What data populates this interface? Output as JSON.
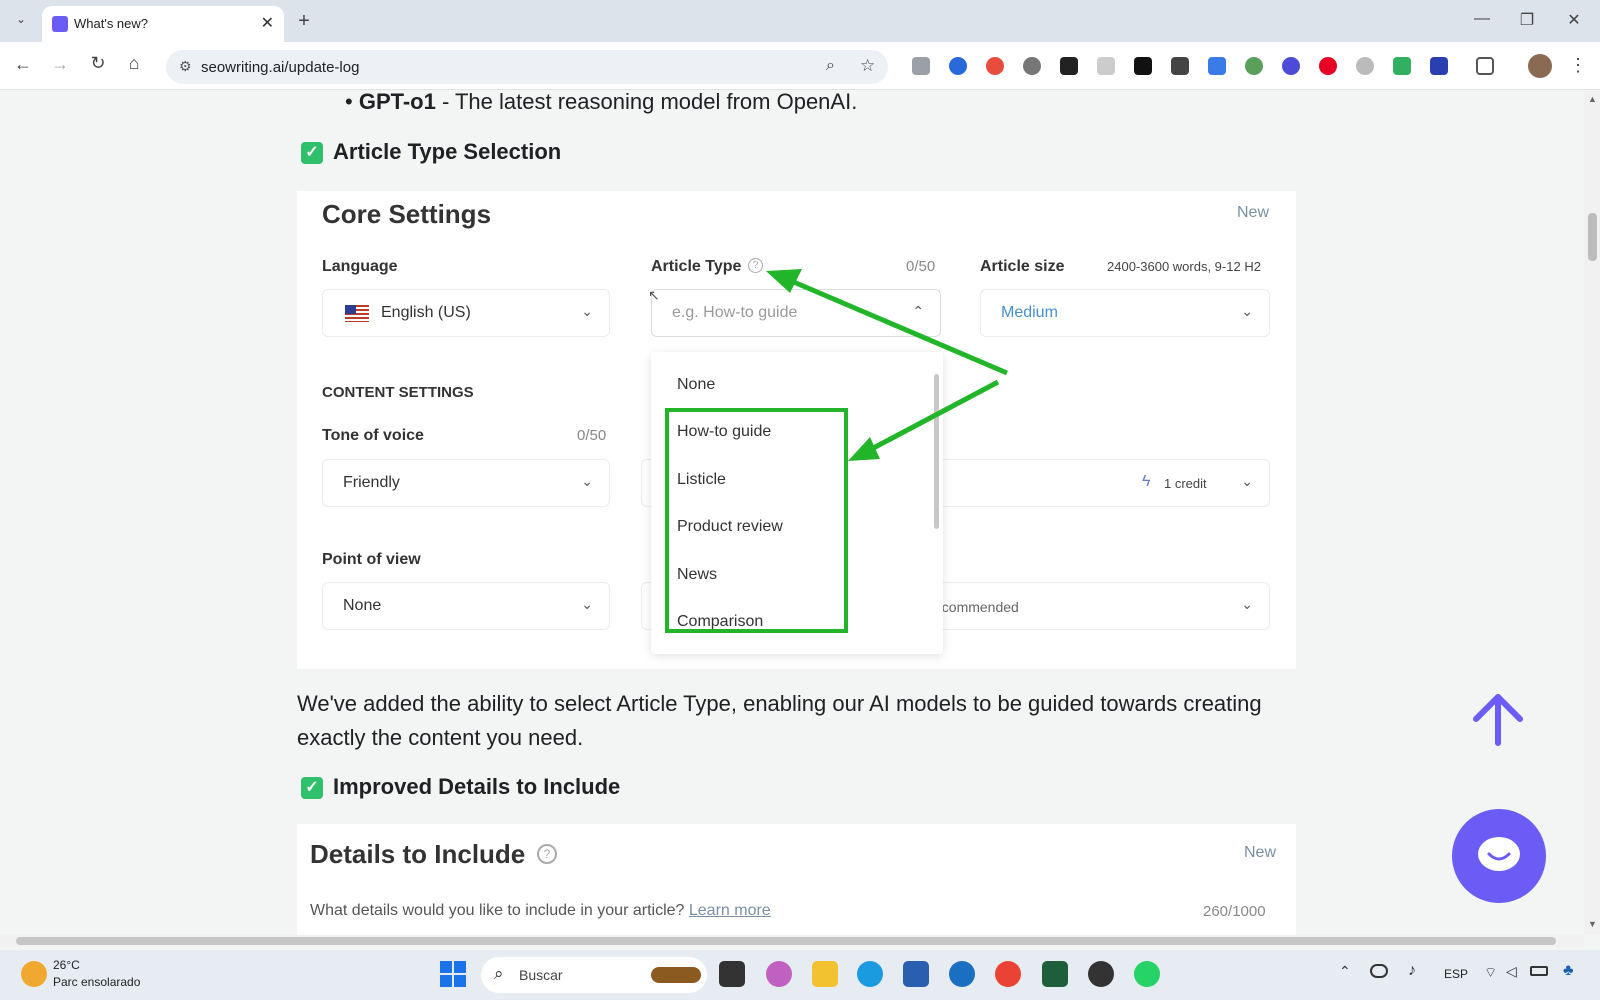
{
  "browser": {
    "tab_title": "What's new?",
    "tab_close": "✕",
    "new_tab": "+",
    "url": "seowriting.ai/update-log",
    "window_controls": [
      "—",
      "❐",
      "✕"
    ]
  },
  "page": {
    "bullet_bold": "GPT-o1",
    "bullet_rest": " - The latest reasoning model from OpenAI.",
    "section1_title": "Article Type Selection",
    "core": {
      "title": "Core Settings",
      "badge": "New",
      "language_label": "Language",
      "language_value": "English (US)",
      "article_type_label": "Article Type",
      "article_type_counter": "0/50",
      "article_type_placeholder": "e.g. How-to guide",
      "article_size_label": "Article size",
      "article_size_hint": "2400-3600 words, 9-12 H2",
      "article_size_value": "Medium",
      "content_settings": "CONTENT SETTINGS",
      "tone_label": "Tone of voice",
      "tone_counter": "0/50",
      "tone_value": "Friendly",
      "credit_text": "1 credit",
      "pov_label": "Point of view",
      "pov_value": "None",
      "recommended_text": "ecommended"
    },
    "dropdown_items": [
      "None",
      "How-to guide",
      "Listicle",
      "Product review",
      "News",
      "Comparison"
    ],
    "paragraph": "We've added the ability to select Article Type, enabling our AI models to be guided towards creating exactly the content you need.",
    "section2_title": "Improved Details to Include",
    "details": {
      "title": "Details to Include",
      "badge": "New",
      "prompt": "What details would you like to include in your article?",
      "learn_more": "Learn more",
      "counter": "260/1000"
    }
  },
  "taskbar": {
    "temp": "26°C",
    "weather": "Parc ensolarado",
    "search_placeholder": "Buscar",
    "lang": "ESP"
  },
  "colors": {
    "accent_purple": "#6b5cf6",
    "check_green": "#2ec06a",
    "annotation_green": "#22b52a",
    "medium_blue": "#4a90c8"
  }
}
